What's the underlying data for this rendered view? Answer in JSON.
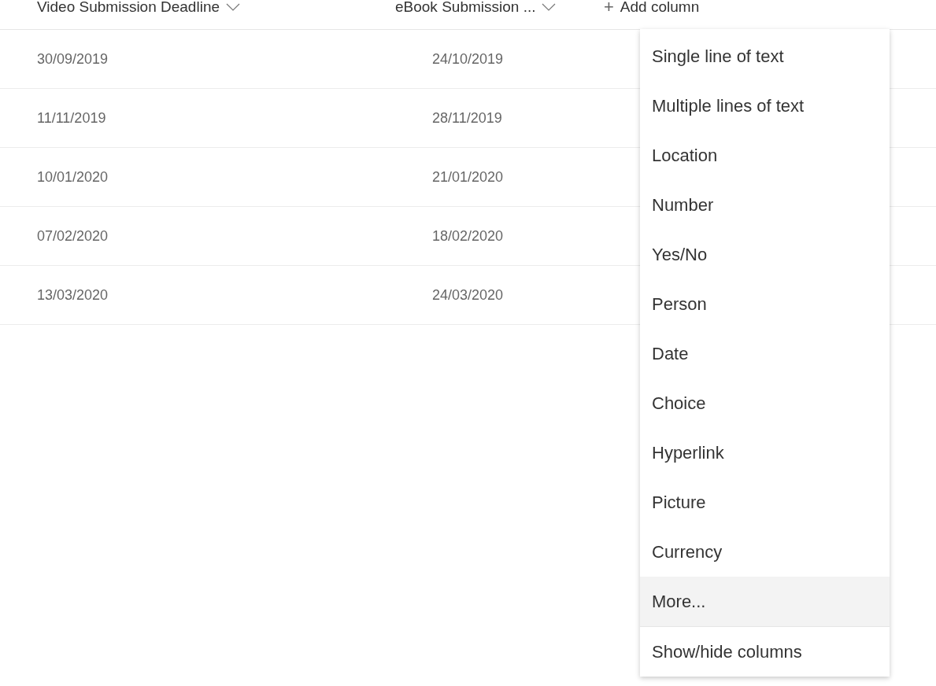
{
  "table": {
    "columns": [
      {
        "label": "Video Submission Deadline"
      },
      {
        "label": "eBook Submission ..."
      }
    ],
    "add_column": {
      "icon": "+",
      "label": "Add column"
    },
    "rows": [
      [
        "30/09/2019",
        "24/10/2019"
      ],
      [
        "11/11/2019",
        "28/11/2019"
      ],
      [
        "10/01/2020",
        "21/01/2020"
      ],
      [
        "07/02/2020",
        "18/02/2020"
      ],
      [
        "13/03/2020",
        "24/03/2020"
      ]
    ]
  },
  "menu": {
    "items": [
      {
        "label": "Single line of text",
        "selected": false
      },
      {
        "label": "Multiple lines of text",
        "selected": false
      },
      {
        "label": "Location",
        "selected": false
      },
      {
        "label": "Number",
        "selected": false
      },
      {
        "label": "Yes/No",
        "selected": false
      },
      {
        "label": "Person",
        "selected": false
      },
      {
        "label": "Date",
        "selected": false
      },
      {
        "label": "Choice",
        "selected": false
      },
      {
        "label": "Hyperlink",
        "selected": false
      },
      {
        "label": "Picture",
        "selected": false
      },
      {
        "label": "Currency",
        "selected": false
      },
      {
        "label": "More...",
        "selected": true
      }
    ],
    "footer_items": [
      {
        "label": "Show/hide columns",
        "selected": false
      }
    ]
  }
}
